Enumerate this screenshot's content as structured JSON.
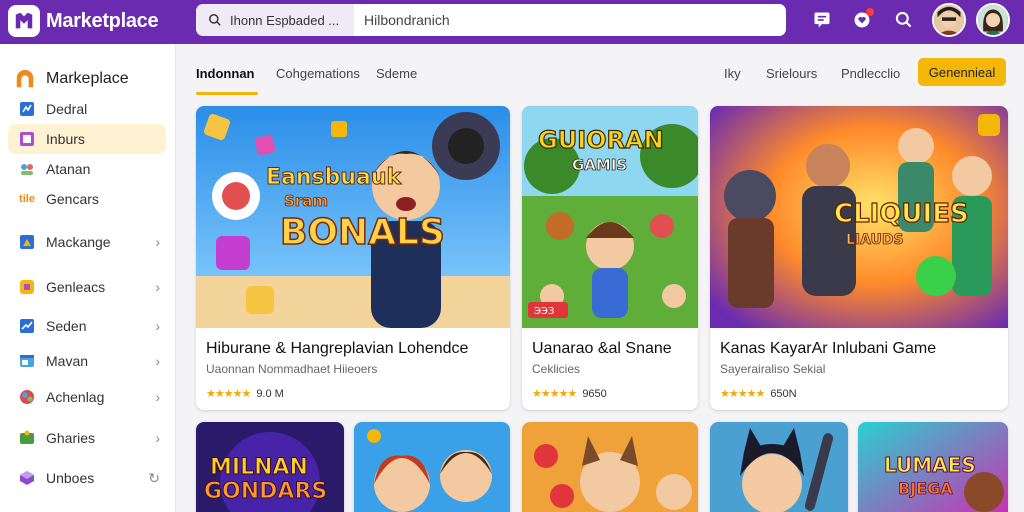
{
  "header": {
    "brand": "Marketplace",
    "search_scope": "Ihonn Espbaded ...",
    "search_value": "Hilbondranich"
  },
  "sidebar": {
    "title": "Markeplace",
    "items": [
      {
        "label": "Dedral",
        "icon": "chart-icon",
        "active": false,
        "chevron": false
      },
      {
        "label": "Inburs",
        "icon": "box-icon",
        "active": true,
        "chevron": false
      },
      {
        "label": "Atanan",
        "icon": "people-icon",
        "active": false,
        "chevron": false
      },
      {
        "label": "Gencars",
        "icon": "tile-icon",
        "active": false,
        "chevron": false
      },
      {
        "label": "Mackange",
        "icon": "chart-icon",
        "active": false,
        "chevron": true
      },
      {
        "label": "Genleacs",
        "icon": "cube-icon",
        "active": false,
        "chevron": true
      },
      {
        "label": "Seden",
        "icon": "trend-icon",
        "active": false,
        "chevron": true
      },
      {
        "label": "Mavan",
        "icon": "window-icon",
        "active": false,
        "chevron": true
      },
      {
        "label": "Achenlag",
        "icon": "globe-icon",
        "active": false,
        "chevron": true
      },
      {
        "label": "Gharies",
        "icon": "puzzle-icon",
        "active": false,
        "chevron": true
      },
      {
        "label": "Unboes",
        "icon": "cube-icon",
        "active": false,
        "chevron": false
      }
    ]
  },
  "subnav": {
    "tabs": [
      "Indonnan",
      "Cohgemations",
      "Sdeme"
    ],
    "filters": [
      "Iky",
      "Srielours",
      "Pndlecclio"
    ],
    "cta": "Genennieal"
  },
  "cards": [
    {
      "title": "Hiburane & Hangreplavian Lohendce",
      "subtitle": "Uaonnan Nommadhaet Hiieoers",
      "stars": "★★★★★",
      "rating": "9.0 M",
      "art_text": "Eansbuauk Sram BONALS"
    },
    {
      "title": "Uanarao &al Snane",
      "subtitle": "Ceklicies",
      "stars": "★★★★★",
      "rating": "9650",
      "art_text": "GUIORAN GAMIS",
      "badge": "ЭЭЗ"
    },
    {
      "title": "Kanas KayarAr Inlubani Game",
      "subtitle": "Sayerairaliso Sekial",
      "stars": "★★★★★",
      "rating": "650N",
      "art_text": "CLIQUIES LIAUDS"
    },
    {
      "title": "",
      "subtitle": "",
      "stars": "",
      "rating": "",
      "art_text": "MILNAN GONDARS"
    },
    {
      "title": "",
      "subtitle": "",
      "stars": "",
      "rating": "",
      "art_text": ""
    },
    {
      "title": "",
      "subtitle": "",
      "stars": "",
      "rating": "",
      "art_text": ""
    },
    {
      "title": "",
      "subtitle": "",
      "stars": "",
      "rating": "",
      "art_text": ""
    },
    {
      "title": "",
      "subtitle": "",
      "stars": "",
      "rating": "",
      "art_text": "LUMAES BJEGA"
    }
  ],
  "colors": {
    "header_bg": "#6a2bb0",
    "accent": "#f5b60a",
    "active_item_bg": "#fdf3d2"
  }
}
